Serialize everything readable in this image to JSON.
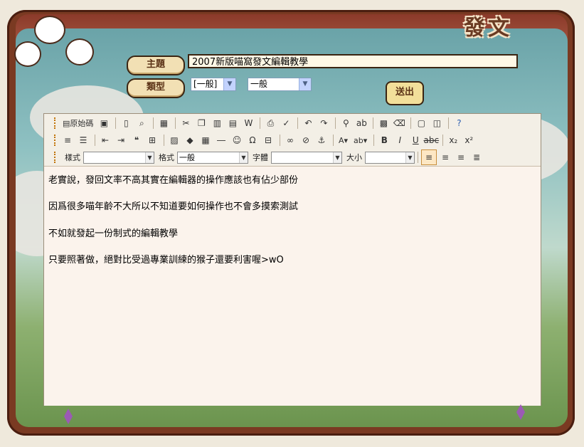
{
  "header": {
    "title_decor": "發文"
  },
  "form": {
    "subject_label": "主題",
    "subject_value": "2007新版喵窩發文編輯教學",
    "type_label": "類型",
    "category_select": "[一般]",
    "type_select": "一般",
    "submit_label": "送出"
  },
  "toolbar": {
    "source_label": "原始碼",
    "style_label": "樣式",
    "format_label": "格式",
    "format_value": "一般",
    "font_label": "字體",
    "size_label": "大小"
  },
  "content": {
    "lines": [
      "老實說，發回文率不高其實在編輯器的操作應該也有佔少部份",
      "因爲很多喵年齡不大所以不知道要如何操作也不會多摸索測試",
      "不如就發起一份制式的編輯教學",
      "只要照著做，絕對比受過專業訓練的猴子還要利害喔>wO"
    ]
  },
  "colors": {
    "frame": "#7a3a22",
    "editor_bg": "#fbf3ec",
    "label_bg": "#f2e0b4"
  }
}
